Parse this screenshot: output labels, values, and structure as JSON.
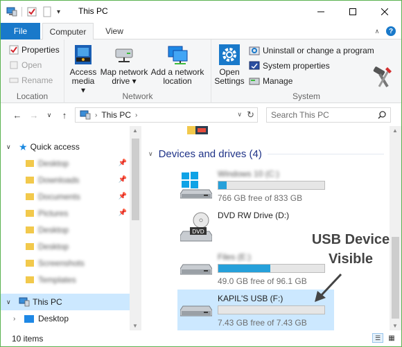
{
  "window": {
    "title": "This PC",
    "controls": [
      "minimize-icon",
      "maximize-icon",
      "close-icon"
    ]
  },
  "ribbon_tabs": {
    "file": "File",
    "computer": "Computer",
    "view": "View"
  },
  "ribbon": {
    "location": {
      "label": "Location",
      "properties": "Properties",
      "open": "Open",
      "rename": "Rename"
    },
    "network": {
      "label": "Network",
      "access_media_1": "Access",
      "access_media_2": "media ▾",
      "map_drive_1": "Map network",
      "map_drive_2": "drive ▾",
      "add_location_1": "Add a network",
      "add_location_2": "location"
    },
    "system": {
      "label": "System",
      "open_settings_1": "Open",
      "open_settings_2": "Settings",
      "uninstall": "Uninstall or change a program",
      "system_properties": "System properties",
      "manage": "Manage"
    }
  },
  "address": {
    "path": "This PC",
    "search_placeholder": "Search This PC"
  },
  "nav_pane": {
    "quick_access": "Quick access",
    "blurred_items": [
      "Desktop",
      "Downloads",
      "Documents",
      "Pictures",
      "Desktop",
      "Desktop",
      "Screenshots",
      "Templates"
    ],
    "this_pc": "This PC",
    "desktop": "Desktop"
  },
  "content": {
    "section_title": "Devices and drives (4)",
    "drives": [
      {
        "name": "Windows 10 (C:)",
        "free": "766 GB free of 833 GB",
        "used_fraction": 0.08,
        "name_blurred": true
      },
      {
        "name": "DVD RW Drive (D:)",
        "free": "",
        "used_fraction": null,
        "name_blurred": false
      },
      {
        "name": "Files (E:)",
        "free": "49.0 GB free of 96.1 GB",
        "used_fraction": 0.49,
        "name_blurred": true
      },
      {
        "name": "KAPIL'S USB (F:)",
        "free": "7.43 GB free of 7.43 GB",
        "used_fraction": 0.0,
        "name_blurred": false
      }
    ],
    "annotation_line1": "USB Device",
    "annotation_line2": "Visible"
  },
  "status": {
    "items": "10 items"
  },
  "colors": {
    "accent": "#1979ca",
    "selection": "#cce8ff",
    "drive_bar_fill": "#26a0da",
    "window_border": "#5ab24f"
  }
}
